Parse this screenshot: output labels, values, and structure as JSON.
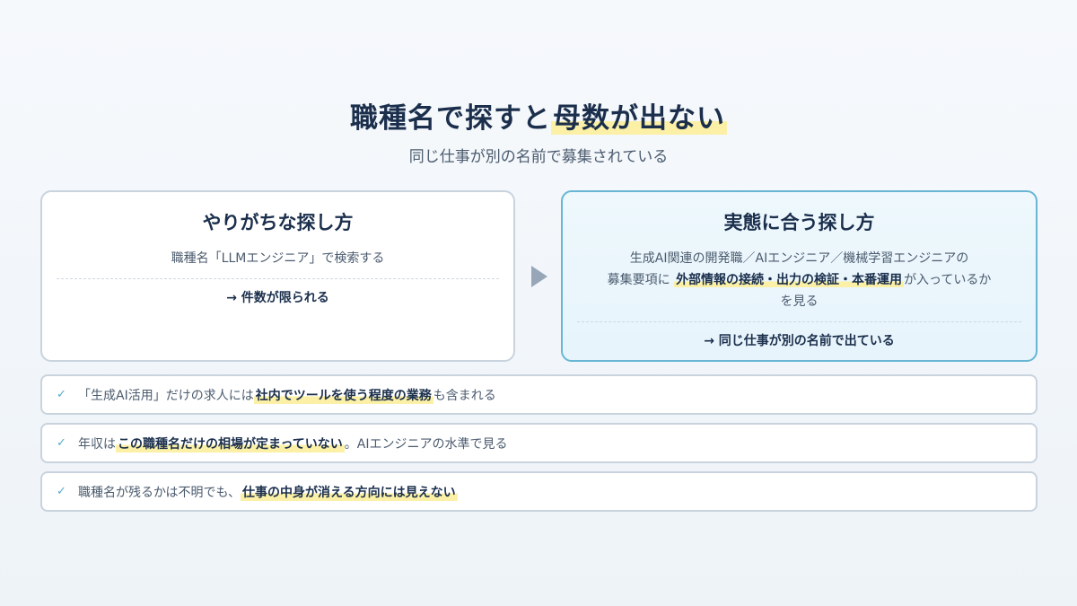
{
  "header": {
    "title_plain": "職種名で探すと",
    "title_highlight": "母数が出ない",
    "subtitle": "同じ仕事が別の名前で募集されている"
  },
  "left_card": {
    "title": "やりがちな探し方",
    "body": "職種名「LLMエンジニア」で検索する",
    "result": "→ 件数が限られる"
  },
  "right_card": {
    "title": "実態に合う探し方",
    "line1": "生成AI関連の開発職／AIエンジニア／機械学習エンジニアの",
    "line2_pre": "募集要項に ",
    "line2_highlight": "外部情報の接続・出力の検証・本番運用",
    "line2_post": "が入っているか",
    "line3": "を見る",
    "result": "→ 同じ仕事が別の名前で出ている"
  },
  "arrow_icon": "triangle-right-icon",
  "check_icon": "checkmark-icon",
  "points": [
    {
      "check": "✓",
      "pre": "「生成AI活用」だけの求人には",
      "highlight": "社内でツールを使う程度の業務",
      "post": "も含まれる"
    },
    {
      "check": "✓",
      "pre": "年収は",
      "highlight": "この職種名だけの相場が定まっていない",
      "post": "。AIエンジニアの水準で見る"
    },
    {
      "check": "✓",
      "pre": "職種名が残るかは不明でも、",
      "highlight": "仕事の中身が消える方向には見えない",
      "post": ""
    }
  ]
}
